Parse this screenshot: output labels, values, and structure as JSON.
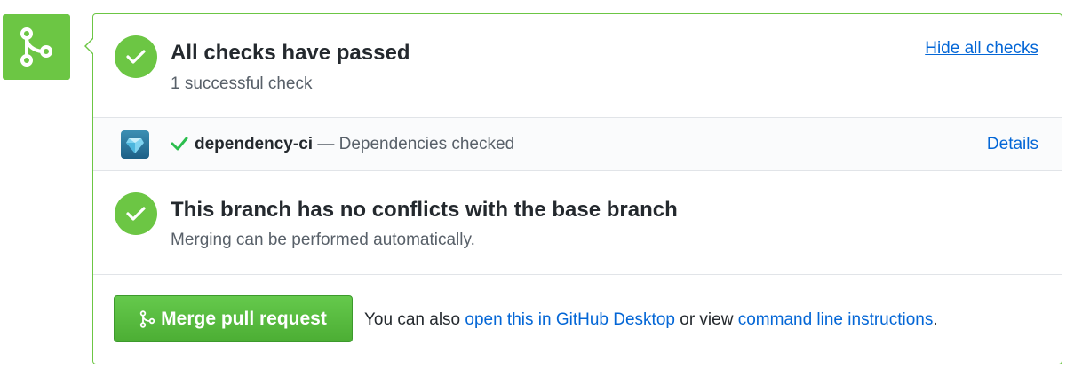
{
  "badge": {
    "icon": "git-merge-icon",
    "color": "#6cc644"
  },
  "checks": {
    "title": "All checks have passed",
    "subtitle": "1 successful check",
    "hide_link": "Hide all checks",
    "icon": "check-icon"
  },
  "status": {
    "avatar_icon": "dependency-ci-logo",
    "check_icon": "check-icon",
    "context": "dependency-ci",
    "separator": " — ",
    "description": "Dependencies checked",
    "details_link": "Details"
  },
  "branch": {
    "title": "This branch has no conflicts with the base branch",
    "subtitle": "Merging can be performed automatically.",
    "icon": "check-icon"
  },
  "merge": {
    "button_label": "Merge pull request",
    "button_icon": "git-merge-icon",
    "note_prefix": "You can also ",
    "desktop_link": "open this in GitHub Desktop",
    "note_middle": " or view ",
    "cli_link": "command line instructions",
    "note_suffix": "."
  },
  "colors": {
    "success": "#6cc644",
    "link": "#0366d6",
    "muted": "#586069",
    "text": "#24292e"
  }
}
